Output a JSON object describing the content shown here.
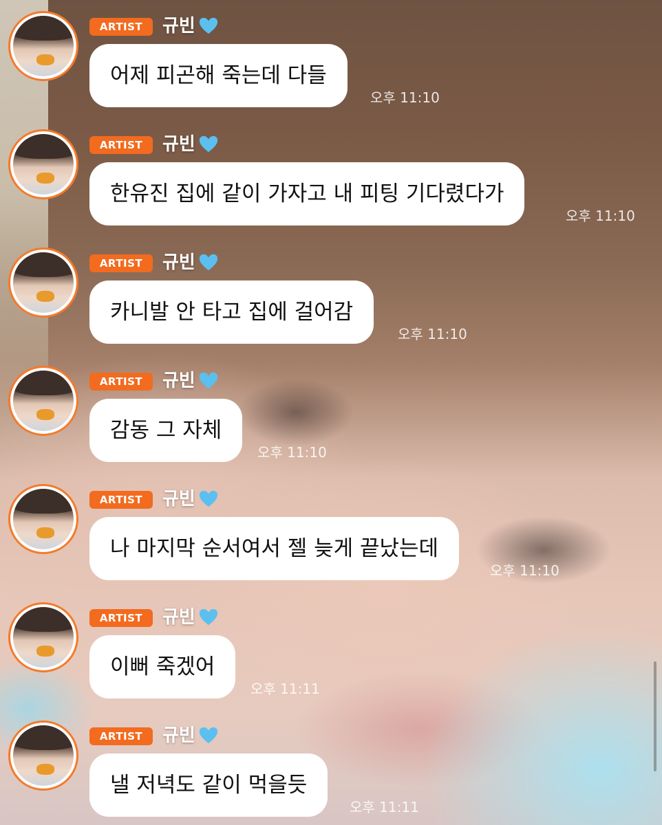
{
  "colors": {
    "badge": "#f26b1f",
    "avatar_ring": "#f47a2a",
    "bubble": "#ffffff",
    "heart": "#5bc0f0"
  },
  "messages": [
    {
      "badge": "ARTIST",
      "sender": "규빈",
      "heart_icon": "blue-heart",
      "text": "어제 피곤해 죽는데 다들",
      "time": "오후 11:10"
    },
    {
      "badge": "ARTIST",
      "sender": "규빈",
      "heart_icon": "blue-heart",
      "text": "한유진 집에 같이 가자고 내 피팅 기다렸다가",
      "time": "오후 11:10"
    },
    {
      "badge": "ARTIST",
      "sender": "규빈",
      "heart_icon": "blue-heart",
      "text": "카니발 안 타고 집에 걸어감",
      "time": "오후 11:10"
    },
    {
      "badge": "ARTIST",
      "sender": "규빈",
      "heart_icon": "blue-heart",
      "text": "감동 그 자체",
      "time": "오후 11:10"
    },
    {
      "badge": "ARTIST",
      "sender": "규빈",
      "heart_icon": "blue-heart",
      "text": "나 마지막 순서여서 젤 늦게 끝났는데",
      "time": "오후 11:10"
    },
    {
      "badge": "ARTIST",
      "sender": "규빈",
      "heart_icon": "blue-heart",
      "text": "이뻐 죽겠어",
      "time": "오후 11:11"
    },
    {
      "badge": "ARTIST",
      "sender": "규빈",
      "heart_icon": "blue-heart",
      "text": "낼 저녁도 같이 먹을듯",
      "time": "오후 11:11"
    }
  ]
}
